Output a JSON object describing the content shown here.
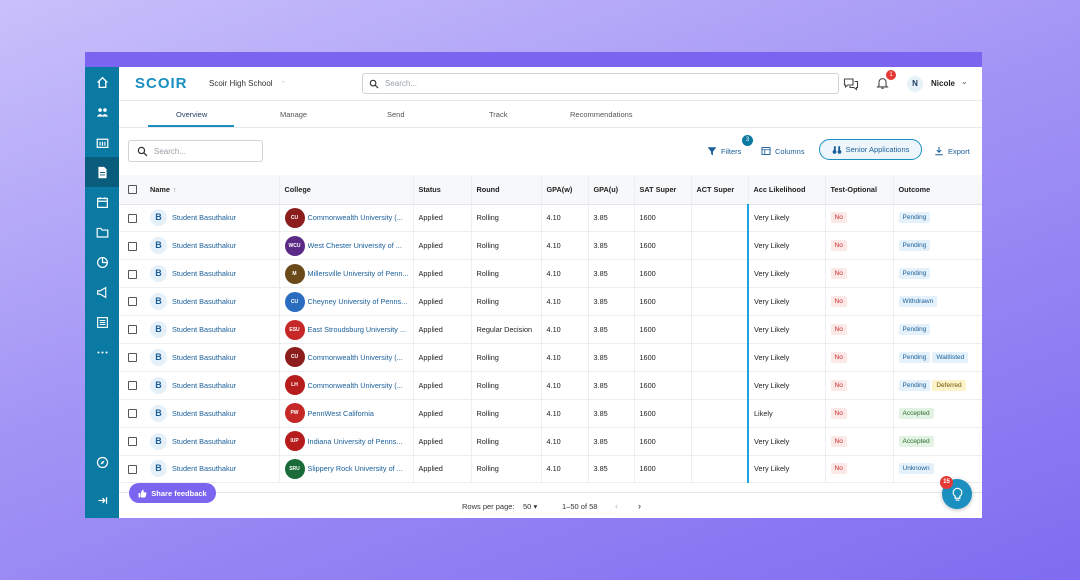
{
  "header": {
    "logo": "SCOIR",
    "school": "Scoir High School",
    "school_caret": "-",
    "search_placeholder": "Search...",
    "notifications_count": "1",
    "user_initial": "N",
    "user_name": "Nicole"
  },
  "tabs": [
    "Overview",
    "Manage",
    "Send",
    "Track",
    "Recommendations"
  ],
  "toolbar": {
    "search_placeholder": "Search...",
    "filters_label": "Filters",
    "filters_count": "3",
    "columns_label": "Columns",
    "senior_label": "Senior Applications",
    "export_label": "Export"
  },
  "table": {
    "columns": [
      "Name",
      "College",
      "Status",
      "Round",
      "GPA(w)",
      "GPA(u)",
      "SAT Super",
      "ACT Super",
      "Acc Likelihood",
      "Test-Optional",
      "Outcome"
    ],
    "rows": [
      {
        "initial": "B",
        "name": "Student Basuthakur",
        "college": "Commonwealth University (...",
        "logo_text": "CU",
        "logo_color": "#8b1d1d",
        "status": "Applied",
        "round": "Rolling",
        "gpaw": "4.10",
        "gpau": "3.85",
        "sat": "1600",
        "act": "",
        "likelihood": "Very Likely",
        "test_optional": "No",
        "outcome": [
          "Pending"
        ]
      },
      {
        "initial": "B",
        "name": "Student Basuthakur",
        "college": "West Chester University of ...",
        "logo_text": "WCU",
        "logo_color": "#5b2a86",
        "status": "Applied",
        "round": "Rolling",
        "gpaw": "4.10",
        "gpau": "3.85",
        "sat": "1600",
        "act": "",
        "likelihood": "Very Likely",
        "test_optional": "No",
        "outcome": [
          "Pending"
        ]
      },
      {
        "initial": "B",
        "name": "Student Basuthakur",
        "college": "Millersville University of Penn...",
        "logo_text": "M",
        "logo_color": "#6b4a1a",
        "status": "Applied",
        "round": "Rolling",
        "gpaw": "4.10",
        "gpau": "3.85",
        "sat": "1600",
        "act": "",
        "likelihood": "Very Likely",
        "test_optional": "No",
        "outcome": [
          "Pending"
        ]
      },
      {
        "initial": "B",
        "name": "Student Basuthakur",
        "college": "Cheyney University of Penns...",
        "logo_text": "CU",
        "logo_color": "#2a6cc0",
        "status": "Applied",
        "round": "Rolling",
        "gpaw": "4.10",
        "gpau": "3.85",
        "sat": "1600",
        "act": "",
        "likelihood": "Very Likely",
        "test_optional": "No",
        "outcome": [
          "Withdrawn"
        ]
      },
      {
        "initial": "B",
        "name": "Student Basuthakur",
        "college": "East Stroudsburg University ...",
        "logo_text": "ESU",
        "logo_color": "#c62828",
        "status": "Applied",
        "round": "Regular Decision",
        "gpaw": "4.10",
        "gpau": "3.85",
        "sat": "1600",
        "act": "",
        "likelihood": "Very Likely",
        "test_optional": "No",
        "outcome": [
          "Pending"
        ]
      },
      {
        "initial": "B",
        "name": "Student Basuthakur",
        "college": "Commonwealth University (...",
        "logo_text": "CU",
        "logo_color": "#8b1d1d",
        "status": "Applied",
        "round": "Rolling",
        "gpaw": "4.10",
        "gpau": "3.85",
        "sat": "1600",
        "act": "",
        "likelihood": "Very Likely",
        "test_optional": "No",
        "outcome": [
          "Pending",
          "Waitlisted"
        ]
      },
      {
        "initial": "B",
        "name": "Student Basuthakur",
        "college": "Commonwealth University (...",
        "logo_text": "LH",
        "logo_color": "#b71c1c",
        "status": "Applied",
        "round": "Rolling",
        "gpaw": "4.10",
        "gpau": "3.85",
        "sat": "1600",
        "act": "",
        "likelihood": "Very Likely",
        "test_optional": "No",
        "outcome": [
          "Pending",
          "Deferred"
        ]
      },
      {
        "initial": "B",
        "name": "Student Basuthakur",
        "college": "PennWest California",
        "logo_text": "PW",
        "logo_color": "#c62828",
        "status": "Applied",
        "round": "Rolling",
        "gpaw": "4.10",
        "gpau": "3.85",
        "sat": "1600",
        "act": "",
        "likelihood": "Likely",
        "test_optional": "No",
        "outcome": [
          "Accepted"
        ]
      },
      {
        "initial": "B",
        "name": "Student Basuthakur",
        "college": "Indiana University of Penns...",
        "logo_text": "IUP",
        "logo_color": "#b71c1c",
        "status": "Applied",
        "round": "Rolling",
        "gpaw": "4.10",
        "gpau": "3.85",
        "sat": "1600",
        "act": "",
        "likelihood": "Very Likely",
        "test_optional": "No",
        "outcome": [
          "Accepted"
        ]
      },
      {
        "initial": "B",
        "name": "Student Basuthakur",
        "college": "Slippery Rock University of ...",
        "logo_text": "SRU",
        "logo_color": "#1b6b3a",
        "status": "Applied",
        "round": "Rolling",
        "gpaw": "4.10",
        "gpau": "3.85",
        "sat": "1600",
        "act": "",
        "likelihood": "Very Likely",
        "test_optional": "No",
        "outcome": [
          "Unknown"
        ]
      }
    ]
  },
  "footer": {
    "feedback_label": "Share feedback",
    "rows_per_page_label": "Rows per page:",
    "rows_per_page_value": "50",
    "range": "1–50 of 58",
    "help_badge": "15"
  },
  "colors": {
    "sidebar": "#0b7aa3",
    "accent": "#1a8fc0",
    "feedback": "#7a64f0"
  }
}
